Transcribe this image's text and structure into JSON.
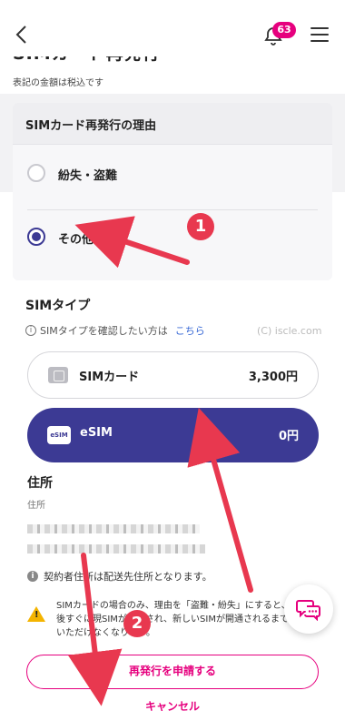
{
  "header": {
    "notification_count": "63",
    "page_title": "SIMカード再発行",
    "tax_note": "表記の金額は税込です"
  },
  "reason": {
    "title": "SIMカード再発行の理由",
    "options": [
      {
        "label": "紛失・盗難",
        "selected": false
      },
      {
        "label": "その他",
        "selected": true
      }
    ]
  },
  "sim_type": {
    "title": "SIMタイプ",
    "info_text": "SIMタイプを確認したい方は",
    "info_link": "こちら",
    "credit": "(C) iscle.com",
    "options": [
      {
        "name": "SIMカード",
        "price": "3,300円",
        "icon": "sim-card-icon",
        "selected": false
      },
      {
        "name": "eSIM",
        "price": "0円",
        "icon": "esim-icon",
        "icon_text": "eSIM",
        "selected": true
      }
    ]
  },
  "address": {
    "title": "住所",
    "sub_label": "住所",
    "note": "契約者住所は配送先住所となります。"
  },
  "warning": {
    "text": "SIMカードの場合のみ、理由を「盗難・紛失」にすると、手続き後すぐに現SIMが停止され、新しいSIMが開通されるまでご利用いただけなくなります。"
  },
  "actions": {
    "apply_label": "再発行を申請する",
    "cancel_label": "キャンセル"
  },
  "annotations": {
    "step1": "1",
    "step2": "2"
  },
  "colors": {
    "accent_pink": "#e6007e",
    "brand_indigo": "#3c3a94",
    "annotation_red": "#e8384f"
  }
}
